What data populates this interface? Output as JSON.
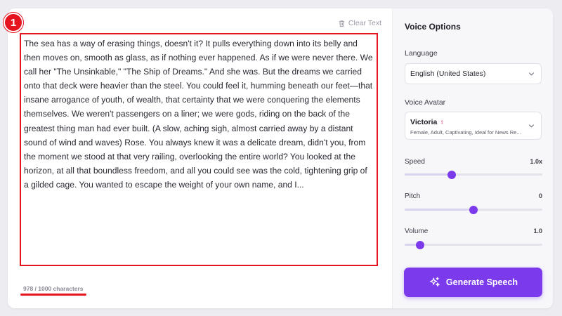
{
  "editor": {
    "clear_label": "Clear Text",
    "text": "The sea has a way of erasing things, doesn't it? It pulls everything down into its belly and then moves on, smooth as glass, as if nothing ever happened. As if we were never there. We call her \"The Unsinkable,\" \"The Ship of Dreams.\" And she was. But the dreams we carried onto that deck were heavier than the steel. You could feel it, humming beneath our feet—that insane arrogance of youth, of wealth, that certainty that we were conquering the elements themselves. We weren't passengers on a liner; we were gods, riding on the back of the greatest thing man had ever built. (A slow, aching sigh, almost carried away by a distant sound of wind and waves) Rose. You always knew it was a delicate dream, didn't you, from the moment we stood at that very railing, overlooking the entire world? You looked at the horizon, at all that boundless freedom, and all you could see was the cold, tightening grip of a gilded cage. You wanted to escape the weight of your own name, and I...",
    "char_count": "978 / 1000 characters",
    "annotation_number": "1"
  },
  "voice_options": {
    "title": "Voice Options",
    "language_label": "Language",
    "language_value": "English (United States)",
    "avatar_label": "Voice Avatar",
    "avatar_name": "Victoria",
    "avatar_gender_icon": "♀",
    "avatar_description": "Female, Adult, Captivating, Ideal for News Re...",
    "speed_label": "Speed",
    "speed_value": "1.0x",
    "speed_level": 0.34,
    "pitch_label": "Pitch",
    "pitch_value": "0",
    "pitch_level": 0.5,
    "volume_label": "Volume",
    "volume_value": "1.0",
    "volume_level": 0.11,
    "generate_label": "Generate Speech"
  },
  "colors": {
    "accent": "#7c3aed",
    "annotation_red": "#e5141f"
  }
}
